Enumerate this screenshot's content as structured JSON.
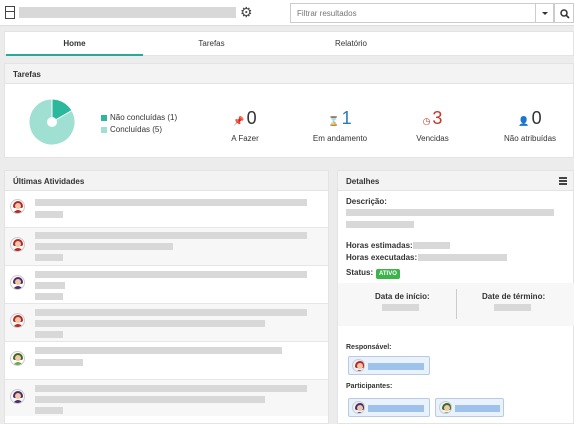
{
  "search": {
    "placeholder": "Filtrar resultados"
  },
  "tabs": [
    {
      "label": "Home",
      "active": true
    },
    {
      "label": "Tarefas",
      "active": false
    },
    {
      "label": "Relatório",
      "active": false
    }
  ],
  "tasks_card": {
    "title": "Tarefas",
    "legend": [
      {
        "label": "Não concluídas (1)",
        "color": "#2cb89c"
      },
      {
        "label": "Concluídas (5)",
        "color": "#9fe0d3"
      }
    ],
    "stats": [
      {
        "value": "0",
        "label": "A Fazer",
        "icon": "pin-icon",
        "color": "#333333"
      },
      {
        "value": "1",
        "label": "Em andamento",
        "icon": "hourglass-icon",
        "color": "#2a7ab8"
      },
      {
        "value": "3",
        "label": "Vencidas",
        "icon": "clock-icon",
        "color": "#c0392b"
      },
      {
        "value": "0",
        "label": "Não atribuídas",
        "icon": "user-icon",
        "color": "#333333"
      }
    ]
  },
  "chart_data": {
    "type": "pie",
    "categories": [
      "Não concluídas",
      "Concluídas"
    ],
    "values": [
      1,
      5
    ],
    "colors": [
      "#2cb89c",
      "#9fe0d3"
    ],
    "legend": "right"
  },
  "activities": {
    "title": "Últimas Atividades"
  },
  "details": {
    "title": "Detalhes",
    "description_label": "Descrição:",
    "hours_estimated_label": "Horas estimadas:",
    "hours_executed_label": "Horas executadas:",
    "status_label": "Status:",
    "status_value": "ATIVO",
    "start_label": "Data de início:",
    "end_label": "Date de término:",
    "responsible_label": "Responsável:",
    "participants_label": "Participantes:"
  }
}
